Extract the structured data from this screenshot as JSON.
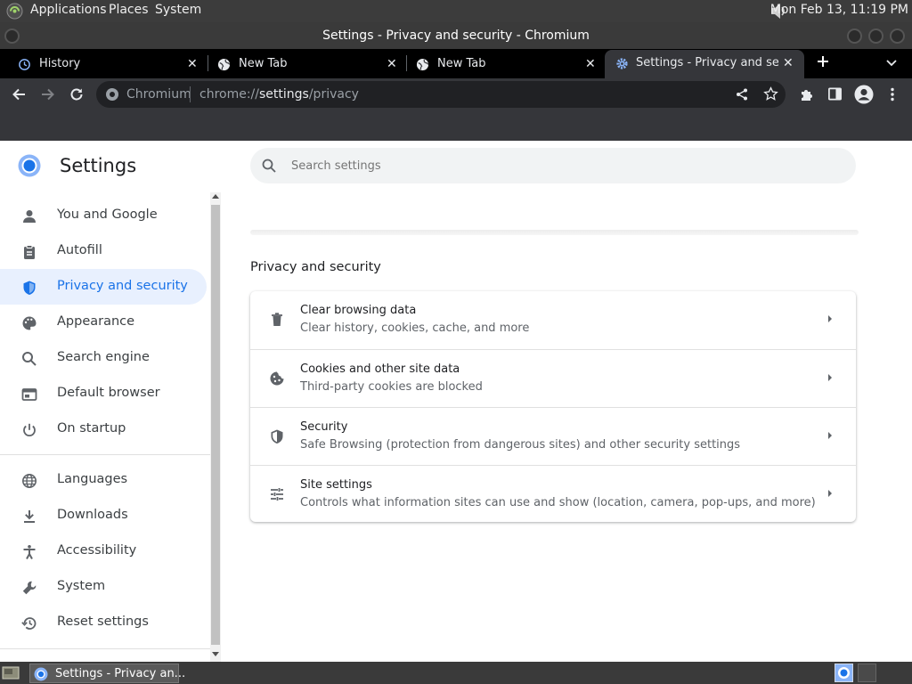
{
  "os_panel": {
    "menus": [
      "Applications",
      "Places",
      "System"
    ],
    "clock": "Mon Feb 13, 11:19 PM"
  },
  "window": {
    "title": "Settings - Privacy and security - Chromium"
  },
  "tabs": [
    {
      "label": "History",
      "icon": "history-icon"
    },
    {
      "label": "New Tab",
      "icon": "globe-icon"
    },
    {
      "label": "New Tab",
      "icon": "globe-icon"
    },
    {
      "label": "Settings - Privacy and security",
      "icon": "gear-icon",
      "active": true
    }
  ],
  "toolbar": {
    "site_label": "Chromium",
    "url_scheme": "chrome://",
    "url_host": "settings",
    "url_path": "/privacy"
  },
  "settings": {
    "title": "Settings",
    "search_placeholder": "Search settings",
    "nav_group1": [
      {
        "label": "You and Google",
        "icon": "person-icon"
      },
      {
        "label": "Autofill",
        "icon": "clipboard-icon"
      },
      {
        "label": "Privacy and security",
        "icon": "shield-icon",
        "active": true
      },
      {
        "label": "Appearance",
        "icon": "palette-icon"
      },
      {
        "label": "Search engine",
        "icon": "search-icon"
      },
      {
        "label": "Default browser",
        "icon": "browser-icon"
      },
      {
        "label": "On startup",
        "icon": "power-icon"
      }
    ],
    "nav_group2": [
      {
        "label": "Languages",
        "icon": "globe-icon"
      },
      {
        "label": "Downloads",
        "icon": "download-icon"
      },
      {
        "label": "Accessibility",
        "icon": "accessibility-icon"
      },
      {
        "label": "System",
        "icon": "wrench-icon"
      },
      {
        "label": "Reset settings",
        "icon": "restore-icon"
      }
    ],
    "section_title": "Privacy and security",
    "rows": [
      {
        "title": "Clear browsing data",
        "subtitle": "Clear history, cookies, cache, and more",
        "icon": "trash-icon"
      },
      {
        "title": "Cookies and other site data",
        "subtitle": "Third-party cookies are blocked",
        "icon": "cookie-icon"
      },
      {
        "title": "Security",
        "subtitle": "Safe Browsing (protection from dangerous sites) and other security settings",
        "icon": "shield-icon"
      },
      {
        "title": "Site settings",
        "subtitle": "Controls what information sites can use and show (location, camera, pop-ups, and more)",
        "icon": "sliders-icon"
      }
    ]
  },
  "taskbar": {
    "task_label": "Settings - Privacy an..."
  },
  "colors": {
    "accent": "#1a73e8",
    "nav_active_bg": "#e8f0fe",
    "toolbar_bg": "#35363a",
    "tabstrip_bg": "#000000"
  }
}
